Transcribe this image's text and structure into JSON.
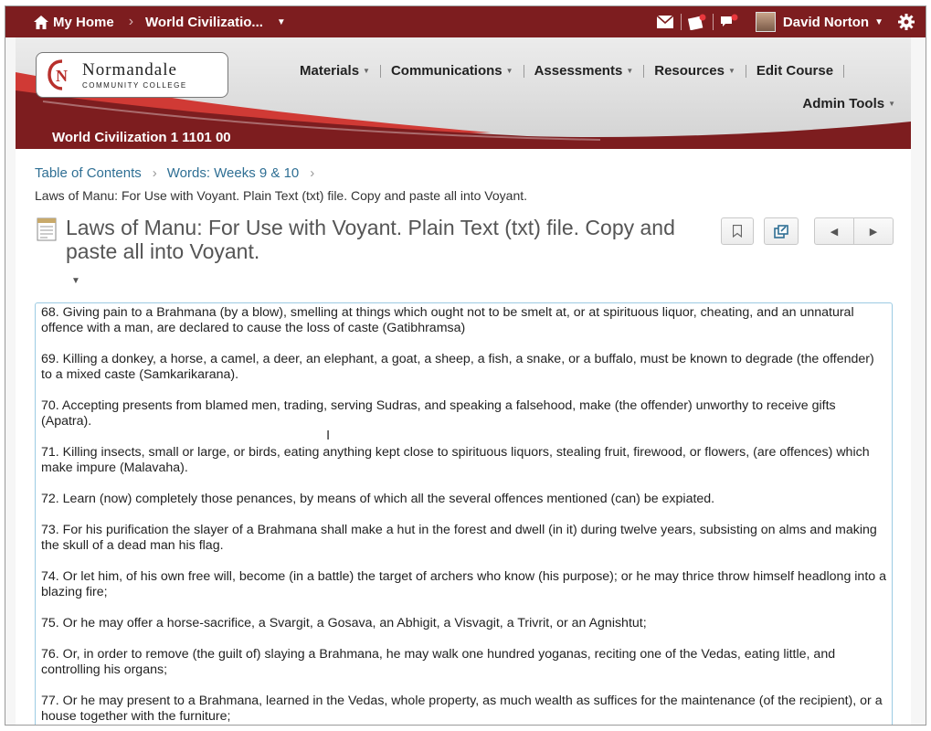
{
  "topbar": {
    "home_label": "My Home",
    "course_label": "World Civilizatio...",
    "user_name": "David Norton",
    "bg_color": "#7d1d1f"
  },
  "branding": {
    "college_name": "Normandale",
    "college_sub": "COMMUNITY COLLEGE",
    "course_title": "World Civilization 1 1101 00"
  },
  "nav": {
    "items": [
      {
        "label": "Materials"
      },
      {
        "label": "Communications"
      },
      {
        "label": "Assessments"
      },
      {
        "label": "Resources"
      },
      {
        "label": "Edit Course"
      }
    ],
    "admin_tools": "Admin Tools"
  },
  "breadcrumb": {
    "items": [
      "Table of Contents",
      "Words: Weeks 9 & 10"
    ],
    "current": "Laws of Manu: For Use with Voyant. Plain Text (txt) file. Copy and paste all into Voyant."
  },
  "page_title": "Laws of Manu: For Use with Voyant. Plain Text (txt) file. Copy and paste all into Voyant.",
  "content": {
    "paragraphs": [
      "68. Giving pain to a Brahmana (by a blow), smelling at things which ought not to be smelt at, or at spirituous liquor, cheating, and an unnatural offence with a man, are declared to cause the loss of caste (Gatibhramsa)",
      "69. Killing a donkey, a horse, a camel, a deer, an elephant, a goat, a sheep, a fish, a snake, or a buffalo, must be known to degrade (the offender) to a mixed caste (Samkarikarana).",
      "70. Accepting presents from blamed men, trading, serving Sudras, and speaking a falsehood, make (the offender) unworthy to receive gifts (Apatra).",
      "71. Killing insects, small or large, or birds, eating anything kept close to spirituous liquors, stealing fruit, firewood, or flowers, (are offences) which make impure (Malavaha).",
      "72. Learn (now) completely those penances, by means of which all the several offences mentioned (can) be expiated.",
      "73. For his purification the slayer of a Brahmana shall make a hut in the forest and dwell (in it) during twelve years, subsisting on alms and making the skull of a dead man his flag.",
      "74. Or let him, of his own free will, become (in a battle) the target of archers who know (his purpose); or he may thrice throw himself headlong into a blazing fire;",
      "75. Or he may offer a horse-sacrifice, a Svargit, a Gosava, an Abhigit, a Visvagit, a Trivrit, or an Agnishtut;",
      "76. Or, in order to remove (the guilt of) slaying a Brahmana, he may walk one hundred yoganas, reciting one of the Vedas, eating little, and controlling his organs;",
      "77. Or he may present to a Brahmana, learned in the Vedas, whole property, as much wealth as suffices for the maintenance (of the recipient), or a house together with the furniture;"
    ]
  },
  "icons": [
    "home-icon",
    "mail-icon",
    "updates-icon",
    "subscriptions-icon",
    "gear-icon",
    "bookmark-icon",
    "external-link-icon",
    "previous-icon",
    "next-icon",
    "document-icon"
  ]
}
